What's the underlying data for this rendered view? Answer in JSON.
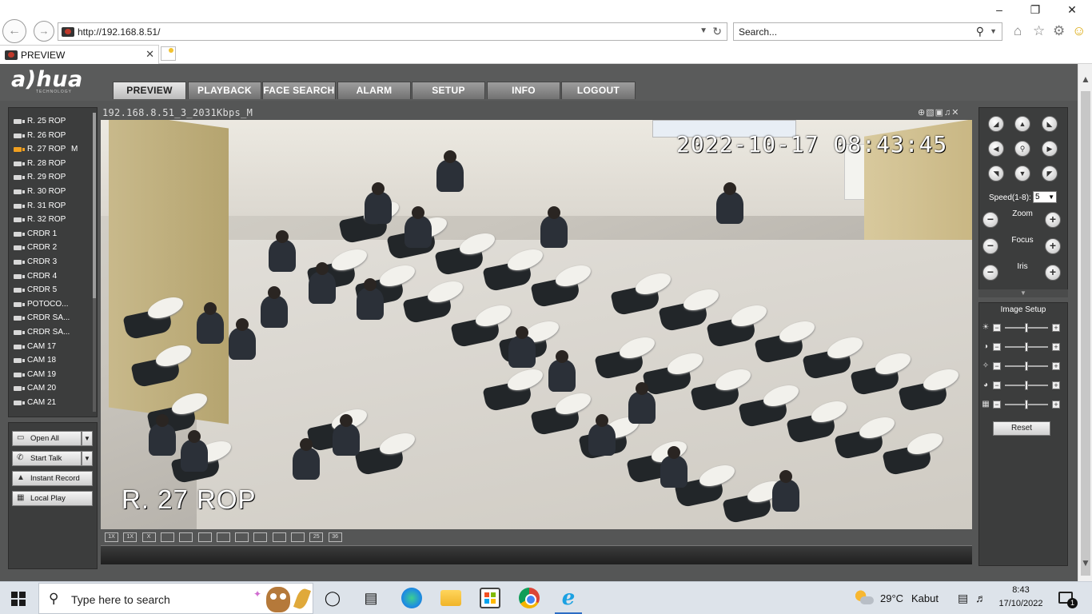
{
  "browser": {
    "url": "http://192.168.8.51/",
    "search_placeholder": "Search...",
    "tab_title": "PREVIEW"
  },
  "app": {
    "logo": "a)hua",
    "logo_sub": "TECHNOLOGY",
    "nav_tabs": [
      "PREVIEW",
      "PLAYBACK",
      "FACE SEARCH",
      "ALARM",
      "SETUP",
      "INFO",
      "LOGOUT"
    ],
    "active_tab": "PREVIEW",
    "channels": [
      {
        "label": "R. 25 ROP",
        "flag": ""
      },
      {
        "label": "R. 26 ROP",
        "flag": ""
      },
      {
        "label": "R. 27 ROP",
        "flag": "M"
      },
      {
        "label": "R. 28 ROP",
        "flag": ""
      },
      {
        "label": "R. 29 ROP",
        "flag": ""
      },
      {
        "label": "R. 30 ROP",
        "flag": ""
      },
      {
        "label": "R. 31 ROP",
        "flag": ""
      },
      {
        "label": "R. 32 ROP",
        "flag": ""
      },
      {
        "label": "CRDR 1",
        "flag": ""
      },
      {
        "label": "CRDR 2",
        "flag": ""
      },
      {
        "label": "CRDR 3",
        "flag": ""
      },
      {
        "label": "CRDR 4",
        "flag": ""
      },
      {
        "label": "CRDR 5",
        "flag": ""
      },
      {
        "label": "POTOCO...",
        "flag": ""
      },
      {
        "label": "CRDR SA...",
        "flag": ""
      },
      {
        "label": "CRDR SA...",
        "flag": ""
      },
      {
        "label": "CAM 17",
        "flag": ""
      },
      {
        "label": "CAM 18",
        "flag": ""
      },
      {
        "label": "CAM 19",
        "flag": ""
      },
      {
        "label": "CAM 20",
        "flag": ""
      },
      {
        "label": "CAM 21",
        "flag": ""
      }
    ],
    "active_channel": 2,
    "buttons": {
      "open_all": "Open All",
      "start_talk": "Start Talk",
      "instant_record": "Instant Record",
      "local_play": "Local Play"
    },
    "video": {
      "title": "192.168.8.51_3_2031Kbps_M",
      "timestamp": "2022-10-17 08:43:45",
      "camera_name": "R. 27 ROP"
    },
    "layout_buttons": [
      "1X",
      "1X",
      "X",
      "",
      "",
      "",
      "",
      "",
      "",
      "",
      "",
      "25",
      "36"
    ],
    "ptz": {
      "speed_label": "Speed(1-8):",
      "speed_value": "5",
      "zoom": "Zoom",
      "focus": "Focus",
      "iris": "Iris"
    },
    "image_setup": {
      "title": "Image Setup",
      "reset": "Reset",
      "sliders": [
        {
          "icon": "brightness-icon",
          "level": 0.5
        },
        {
          "icon": "contrast-icon",
          "level": 0.5
        },
        {
          "icon": "saturation-icon",
          "level": 0.5
        },
        {
          "icon": "hue-icon",
          "level": 0.5
        },
        {
          "icon": "sharpness-icon",
          "level": 0.5
        }
      ]
    }
  },
  "taskbar": {
    "search_text": "Type here to search",
    "temperature": "29°C",
    "weather": "Kabut",
    "time": "8:43",
    "date": "17/10/2022",
    "notifications": "1"
  }
}
